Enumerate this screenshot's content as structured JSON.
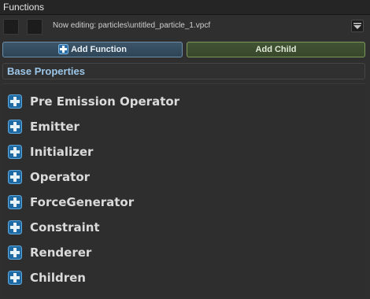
{
  "window": {
    "title": "Functions"
  },
  "toolbar": {
    "editing_text": "Now editing: particles\\untitled_particle_1.vpcf",
    "dropdown_icon": "chevron-down-icon"
  },
  "actions": {
    "add_function_label": "Add Function",
    "add_child_label": "Add Child"
  },
  "section": {
    "title": "Base Properties"
  },
  "colors": {
    "accent_blue": "#3f8fd2",
    "add_function_bg": "#3c5568",
    "add_child_bg": "#425434",
    "section_text": "#9cc6e8"
  },
  "categories": [
    {
      "label": "Pre Emission Operator",
      "icon": "plus-icon"
    },
    {
      "label": "Emitter",
      "icon": "plus-icon"
    },
    {
      "label": "Initializer",
      "icon": "plus-icon"
    },
    {
      "label": "Operator",
      "icon": "plus-icon"
    },
    {
      "label": "ForceGenerator",
      "icon": "plus-icon"
    },
    {
      "label": "Constraint",
      "icon": "plus-icon"
    },
    {
      "label": "Renderer",
      "icon": "plus-icon"
    },
    {
      "label": "Children",
      "icon": "plus-icon"
    }
  ]
}
